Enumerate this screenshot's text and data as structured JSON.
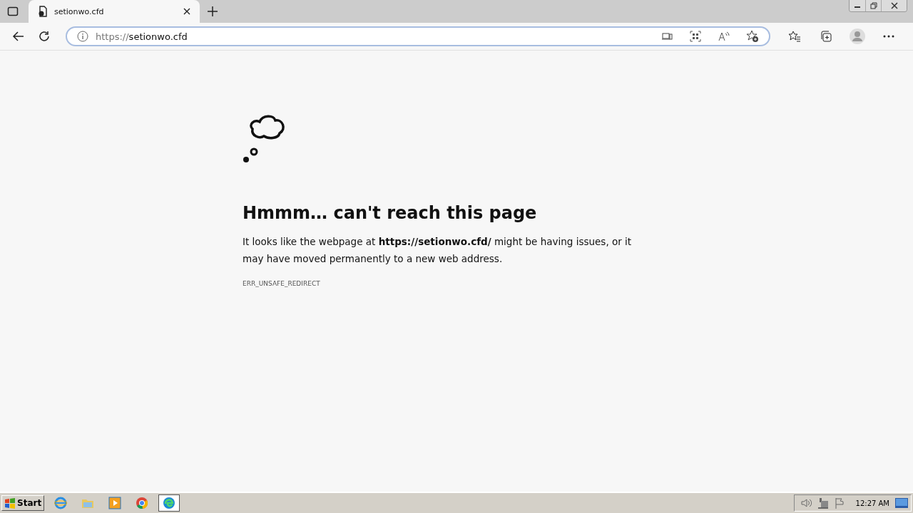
{
  "tabs": [
    {
      "title": "setionwo.cfd",
      "selected": true
    }
  ],
  "address_bar": {
    "scheme": "https://",
    "host": "setionwo.cfd"
  },
  "error": {
    "heading": "Hmmm… can't reach this page",
    "message": "It looks like the webpage at **https://setionwo.cfd/** might be having issues, or it may have moved permanently to a new web address.",
    "code": "ERR_UNSAFE_REDIRECT"
  },
  "taskbar": {
    "start_label": "Start",
    "apps": [
      {
        "kind": "ie",
        "selected": false
      },
      {
        "kind": "folder",
        "selected": false
      },
      {
        "kind": "media",
        "selected": false
      },
      {
        "kind": "chrome",
        "selected": false
      },
      {
        "kind": "edge",
        "selected": true
      }
    ],
    "clock": "12:27 AM"
  }
}
